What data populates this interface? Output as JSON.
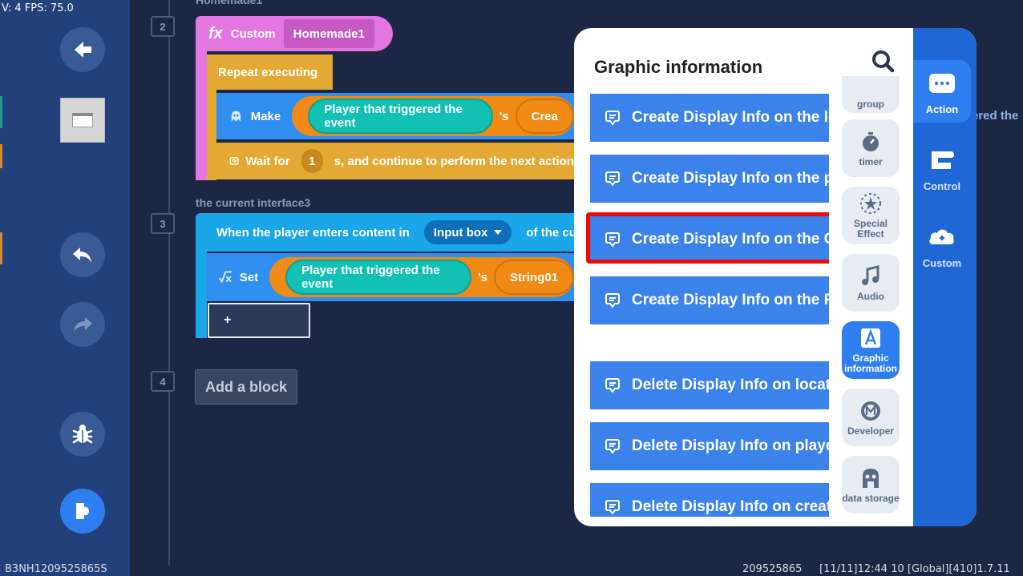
{
  "overlay": {
    "fps_text": "V: 4 FPS: 75.0"
  },
  "workspace": {
    "step_numbers": [
      "2",
      "3",
      "4"
    ],
    "ghost_labels": {
      "top": "Homemade1",
      "interface": "the current interface3"
    },
    "block_custom": {
      "fx": "fx",
      "label": "Custom",
      "name": "Homemade1"
    },
    "block_repeat": {
      "label": "Repeat executing"
    },
    "block_make": {
      "label": "Make",
      "player": "Player that triggered the event",
      "suffix": "'s",
      "partial": "Crea"
    },
    "block_wait": {
      "label": "Wait for",
      "value": "1",
      "rest": "s, and continue to perform the next action"
    },
    "block_when": {
      "label": "When the player enters content in",
      "dropdown": "Input box",
      "rest": "of the current"
    },
    "block_set": {
      "label": "Set",
      "player": "Player that triggered the event",
      "suffix": "'s",
      "variable": "String01"
    },
    "plus_label": "+",
    "add_block_label": "Add a block",
    "behind_text": "ered the"
  },
  "status_bar": {
    "left": "B3NH1209525865S",
    "id": "209525865",
    "right": "[11/11]12:44 10  [Global][410]1.7.11"
  },
  "panel": {
    "title": "Graphic information",
    "items": [
      "Create Display Info on the location",
      "Create Display Info on the player",
      "Create Display Info on the Creature",
      "Create Display Info on the Projectile",
      "Delete Display Info on location",
      "Delete Display Info on player",
      "Delete Display Info on creature"
    ],
    "categories": [
      {
        "label": "group",
        "icon": "group-icon"
      },
      {
        "label": "timer",
        "icon": "timer-icon"
      },
      {
        "label": "Special Effect",
        "icon": "special-effect-icon"
      },
      {
        "label": "Audio",
        "icon": "audio-icon"
      },
      {
        "label": "Graphic information",
        "icon": "graphic-info-icon"
      },
      {
        "label": "Developer",
        "icon": "developer-icon"
      },
      {
        "label": "data storage",
        "icon": "data-storage-icon"
      }
    ],
    "tabs": [
      {
        "label": "Action",
        "icon": "action-icon"
      },
      {
        "label": "Control",
        "icon": "control-icon"
      },
      {
        "label": "Custom",
        "icon": "custom-icon"
      }
    ]
  },
  "colors": {
    "highlight": "#ee0a0a",
    "list_item": "#3b82ea",
    "tab_bar": "#1e67d4",
    "accent": "#2f7ef0"
  }
}
